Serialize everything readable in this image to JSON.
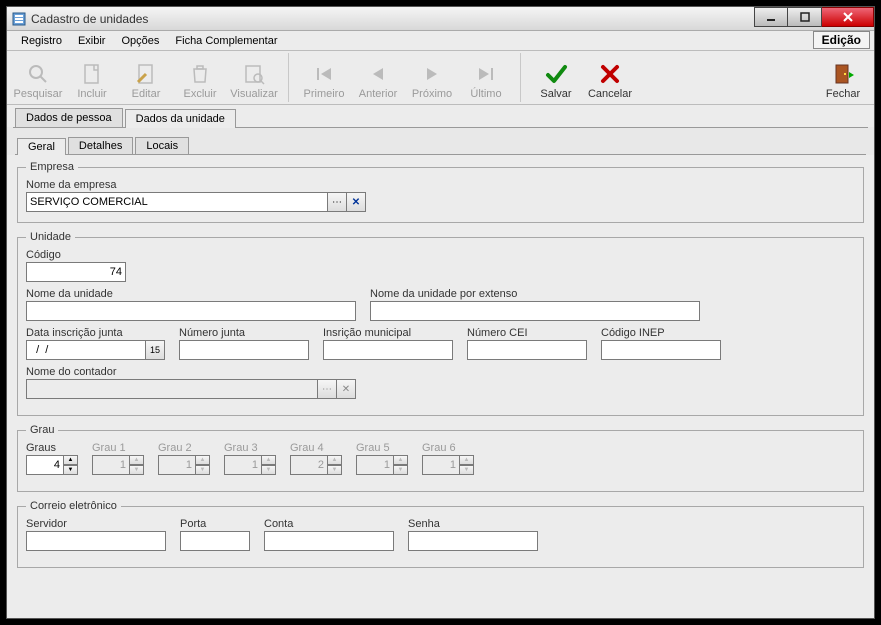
{
  "window": {
    "title": "Cadastro de unidades",
    "mode": "Edição"
  },
  "menu": {
    "items": [
      "Registro",
      "Exibir",
      "Opções",
      "Ficha Complementar"
    ]
  },
  "toolbar": {
    "pesquisar": "Pesquisar",
    "incluir": "Incluir",
    "editar": "Editar",
    "excluir": "Excluir",
    "visualizar": "Visualizar",
    "primeiro": "Primeiro",
    "anterior": "Anterior",
    "proximo": "Próximo",
    "ultimo": "Último",
    "salvar": "Salvar",
    "cancelar": "Cancelar",
    "fechar": "Fechar"
  },
  "tabs": {
    "main": [
      "Dados de pessoa",
      "Dados da unidade"
    ],
    "sub": [
      "Geral",
      "Detalhes",
      "Locais"
    ]
  },
  "empresa": {
    "legend": "Empresa",
    "nome_label": "Nome da empresa",
    "nome_value": "SERVIÇO COMERCIAL"
  },
  "unidade": {
    "legend": "Unidade",
    "codigo_label": "Código",
    "codigo_value": "74",
    "nome_label": "Nome da unidade",
    "nome_value": "",
    "nome_ext_label": "Nome da unidade por extenso",
    "nome_ext_value": "",
    "data_inscricao_label": "Data inscrição junta",
    "data_inscricao_value": "  /  /",
    "numero_junta_label": "Número junta",
    "numero_junta_value": "",
    "insc_municipal_label": "Insrição municipal",
    "insc_municipal_value": "",
    "numero_cei_label": "Número CEI",
    "numero_cei_value": "",
    "codigo_inep_label": "Código INEP",
    "codigo_inep_value": "",
    "contador_label": "Nome do contador",
    "contador_value": ""
  },
  "grau": {
    "legend": "Grau",
    "graus_label": "Graus",
    "graus_value": "4",
    "g1_label": "Grau 1",
    "g1_value": "1",
    "g2_label": "Grau 2",
    "g2_value": "1",
    "g3_label": "Grau 3",
    "g3_value": "1",
    "g4_label": "Grau 4",
    "g4_value": "2",
    "g5_label": "Grau 5",
    "g5_value": "1",
    "g6_label": "Grau 6",
    "g6_value": "1"
  },
  "email": {
    "legend": "Correio eletrônico",
    "servidor_label": "Servidor",
    "servidor_value": "",
    "porta_label": "Porta",
    "porta_value": "",
    "conta_label": "Conta",
    "conta_value": "",
    "senha_label": "Senha",
    "senha_value": ""
  }
}
